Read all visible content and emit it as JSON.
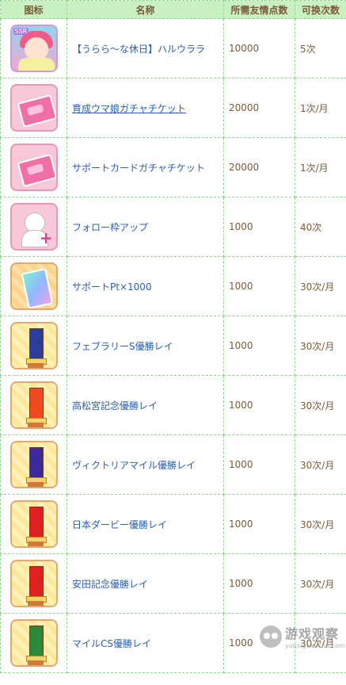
{
  "headers": {
    "icon": "图标",
    "name": "名称",
    "cost": "所需友情点数",
    "limit": "可换次数"
  },
  "rows": [
    {
      "icon": "character-portrait-icon",
      "name": "【うらら～な休日】ハルウララ",
      "cost": "10000",
      "limit": "5次",
      "link": false,
      "style": "portrait"
    },
    {
      "icon": "gacha-ticket-icon",
      "name": "育成ウマ娘ガチャチケット",
      "cost": "20000",
      "limit": "1次/月",
      "link": true,
      "style": "pink"
    },
    {
      "icon": "support-ticket-icon",
      "name": "サポートカードガチャチケット",
      "cost": "20000",
      "limit": "1次/月",
      "link": false,
      "style": "pink"
    },
    {
      "icon": "follow-slot-icon",
      "name": "フォロー枠アップ",
      "cost": "1000",
      "limit": "40次",
      "link": false,
      "style": "pink"
    },
    {
      "icon": "support-pt-card-icon",
      "name": "サポートPt×1000",
      "cost": "1000",
      "limit": "30次/月",
      "link": false,
      "style": "orange"
    },
    {
      "icon": "victory-sash-icon",
      "name": "フェブラリーS優勝レイ",
      "cost": "1000",
      "limit": "30次/月",
      "link": false,
      "style": "yellow",
      "sash": "#2a3c9c"
    },
    {
      "icon": "victory-sash-icon",
      "name": "高松宮記念優勝レイ",
      "cost": "1000",
      "limit": "30次/月",
      "link": false,
      "style": "yellow",
      "sash": "#f04a20"
    },
    {
      "icon": "victory-sash-icon",
      "name": "ヴィクトリアマイル優勝レイ",
      "cost": "1000",
      "limit": "30次/月",
      "link": false,
      "style": "yellow",
      "sash": "#3a2a9a"
    },
    {
      "icon": "victory-sash-icon",
      "name": "日本ダービー優勝レイ",
      "cost": "1000",
      "limit": "30次/月",
      "link": false,
      "style": "yellow",
      "sash": "#e02020"
    },
    {
      "icon": "victory-sash-icon",
      "name": "安田記念優勝レイ",
      "cost": "1000",
      "limit": "30次/月",
      "link": false,
      "style": "yellow",
      "sash": "#e02020"
    },
    {
      "icon": "victory-sash-icon",
      "name": "マイルCS優勝レイ",
      "cost": "1000",
      "limit": "30次/月",
      "link": false,
      "style": "yellow",
      "sash": "#2a8a3a"
    }
  ],
  "watermark": {
    "cn": "游戏观察",
    "en": "youxiguancha.com"
  }
}
